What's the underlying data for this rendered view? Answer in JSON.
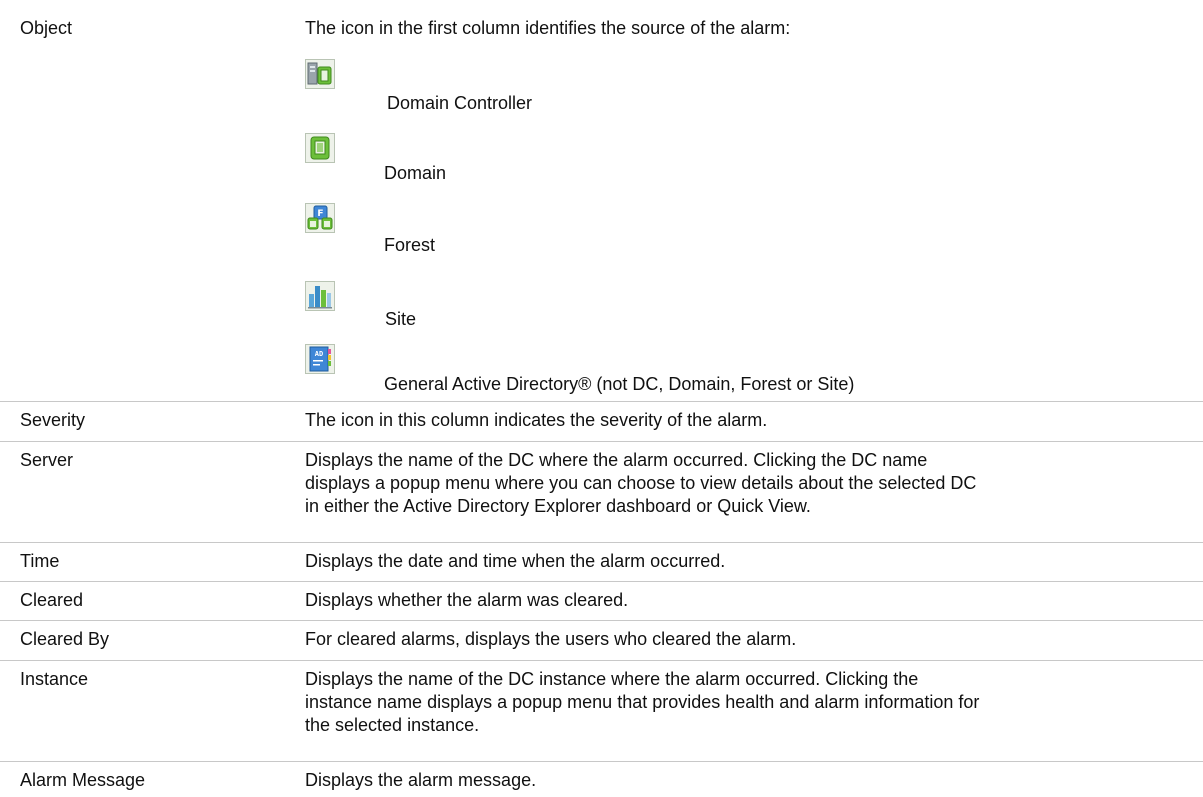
{
  "object_row": {
    "label": "Object",
    "description": "The icon in the first column identifies the source of the alarm:",
    "sources": [
      {
        "icon": "domain-controller-icon",
        "label": "Domain Controller"
      },
      {
        "icon": "domain-icon",
        "label": "Domain"
      },
      {
        "icon": "forest-icon",
        "label": "Forest"
      },
      {
        "icon": "site-icon",
        "label": "Site"
      },
      {
        "icon": "general-active-directory-icon",
        "label": "General Active Directory® (not DC, Domain, Forest or Site)"
      }
    ]
  },
  "rows": [
    {
      "label": "Severity",
      "description": "The icon in this column indicates the severity of the alarm."
    },
    {
      "label": "Server",
      "description_lines": [
        "Displays the name of the DC where the alarm occurred. Clicking the DC name",
        "displays a popup menu where you can choose to view details about the selected DC",
        "in either the Active Directory Explorer dashboard or Quick View."
      ]
    },
    {
      "label": "Time",
      "description": "Displays the date and time when the alarm occurred."
    },
    {
      "label": "Cleared",
      "description": "Displays whether the alarm was cleared."
    },
    {
      "label": "Cleared By",
      "description": "For cleared alarms, displays the users who cleared the alarm."
    },
    {
      "label": "Instance",
      "description_lines": [
        "Displays the name of the DC instance where the alarm occurred. Clicking the",
        "instance name displays a popup menu that provides health and alarm information for",
        "the selected instance."
      ]
    },
    {
      "label": "Alarm Message",
      "description": "Displays the alarm message."
    }
  ],
  "colors": {
    "separator": "#c8c8c8",
    "text": "#111111"
  }
}
